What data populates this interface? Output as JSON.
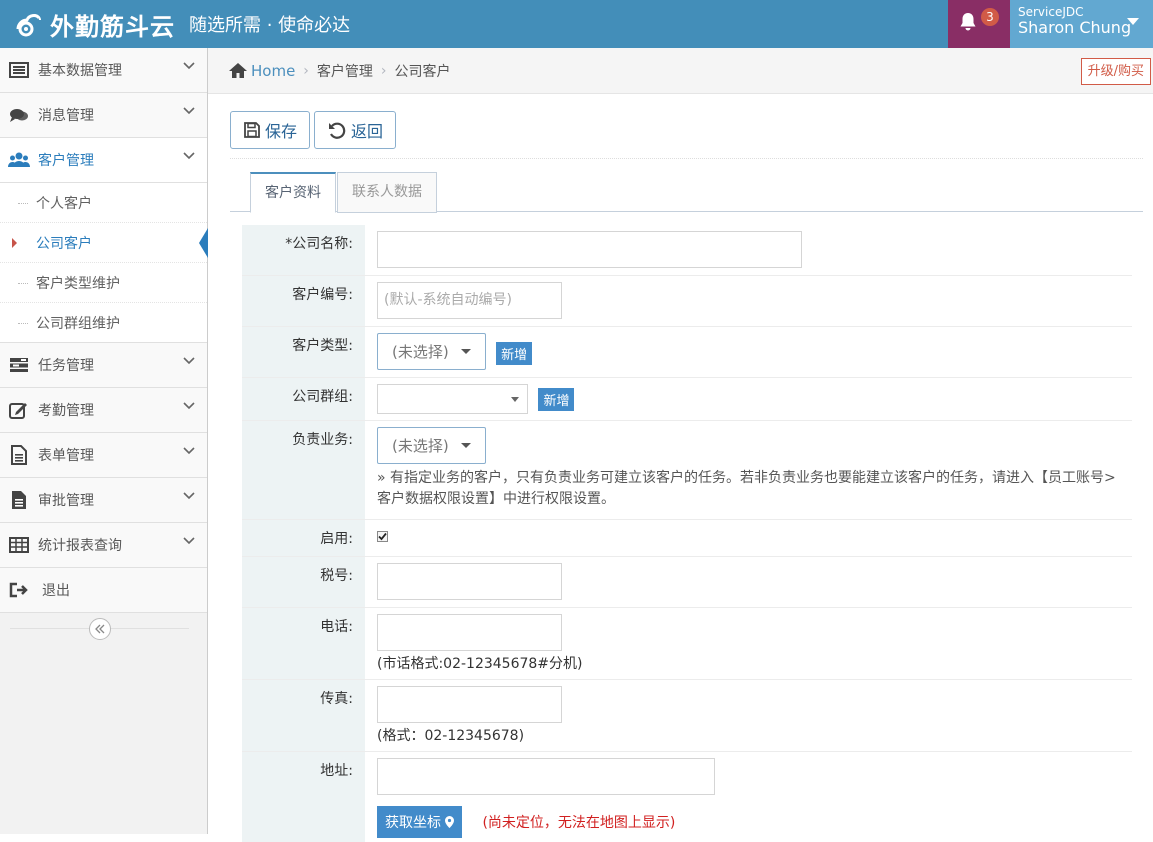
{
  "header": {
    "app_name": "外勤筋斗云",
    "slogan": "随选所需 · 使命必达",
    "notification_count": "3",
    "company": "ServiceJDC",
    "user_name": "Sharon Chung"
  },
  "sidebar": {
    "items": [
      {
        "label": "基本数据管理",
        "icon": "list-icon"
      },
      {
        "label": "消息管理",
        "icon": "comments-icon"
      },
      {
        "label": "客户管理",
        "icon": "users-icon"
      },
      {
        "label": "任务管理",
        "icon": "tasks-icon"
      },
      {
        "label": "考勤管理",
        "icon": "edit-icon"
      },
      {
        "label": "表单管理",
        "icon": "file-icon"
      },
      {
        "label": "审批管理",
        "icon": "file-text-icon"
      },
      {
        "label": "统计报表查询",
        "icon": "table-icon"
      },
      {
        "label": "退出",
        "icon": "signout-icon"
      }
    ],
    "customer_sub": [
      {
        "label": "个人客户"
      },
      {
        "label": "公司客户"
      },
      {
        "label": "客户类型维护"
      },
      {
        "label": "公司群组维护"
      }
    ]
  },
  "breadcrumb": {
    "home": "Home",
    "level1": "客户管理",
    "level2": "公司客户",
    "upgrade": "升级/购买"
  },
  "toolbar": {
    "save_label": "保存",
    "back_label": "返回"
  },
  "tabs": [
    {
      "label": "客户资料",
      "active": true
    },
    {
      "label": "联系人数据",
      "active": false
    }
  ],
  "form": {
    "company_name_label": "*公司名称:",
    "customer_no_label": "客户编号:",
    "customer_no_placeholder": "(默认-系统自动编号)",
    "customer_type_label": "客户类型:",
    "customer_type_value": "(未选择)",
    "add_label": "新增",
    "group_label": "公司群组:",
    "sales_label": "负责业务:",
    "sales_value": "(未选择)",
    "sales_hint": "» 有指定业务的客户，只有负责业务可建立该客户的任务。若非负责业务也要能建立该客户的任务，请进入【员工账号>客户数据权限设置】中进行权限设置。",
    "enabled_label": "启用:",
    "enabled": true,
    "tax_label": "税号:",
    "phone_label": "电话:",
    "phone_note": "(市话格式:02-12345678#分机)",
    "fax_label": "传真:",
    "fax_note": "(格式：02-12345678)",
    "address_label": "地址:",
    "geo_button": "获取坐标",
    "geo_warning": "(尚未定位，无法在地图上显示)"
  }
}
